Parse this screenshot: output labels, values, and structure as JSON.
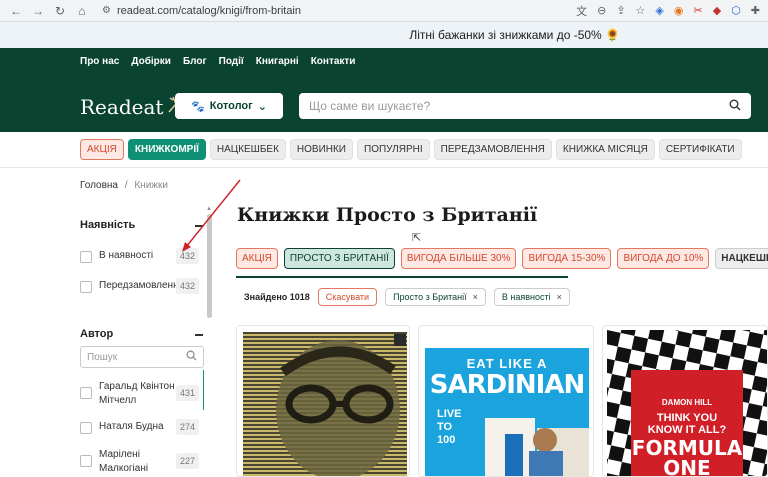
{
  "browser": {
    "url": "readeat.com/catalog/knigi/from-britain"
  },
  "promo": {
    "text": "Літні бажанки зі знижками до -50% 🌻"
  },
  "header": {
    "nav": [
      "Про нас",
      "Добірки",
      "Блог",
      "Події",
      "Книгарні",
      "Контакти"
    ],
    "logo": "Readeat",
    "catalog_label": "Котолог",
    "search_placeholder": "Що саме ви шукаєте?"
  },
  "tags": [
    {
      "label": "АКЦІЯ",
      "style": "red"
    },
    {
      "label": "КНИЖКОМРІЇ",
      "style": "green"
    },
    {
      "label": "НАЦКЕШБЕК",
      "style": "grey"
    },
    {
      "label": "НОВИНКИ",
      "style": "grey"
    },
    {
      "label": "ПОПУЛЯРНІ",
      "style": "grey"
    },
    {
      "label": "ПЕРЕДЗАМОВЛЕННЯ",
      "style": "grey"
    },
    {
      "label": "КНИЖКА МІСЯЦЯ",
      "style": "grey"
    },
    {
      "label": "СЕРТИФІКАТИ",
      "style": "grey"
    }
  ],
  "breadcrumb": {
    "home": "Головна",
    "sep": "/",
    "current": "Книжки"
  },
  "filters": {
    "availability": {
      "title": "Наявність",
      "items": [
        {
          "label": "В наявності",
          "count": "432"
        },
        {
          "label": "Передзамовлення",
          "count": "432"
        }
      ]
    },
    "author": {
      "title": "Автор",
      "search_placeholder": "Пошук",
      "items": [
        {
          "label": "Гаральд Квінтон Мітчелл",
          "count": "431"
        },
        {
          "label": "Наталя Будна",
          "count": "274"
        },
        {
          "label": "Марілені Малкогіані",
          "count": "227"
        }
      ]
    }
  },
  "main": {
    "title": "Книжки Просто з Британії",
    "filter_tags": [
      {
        "label": "АКЦІЯ",
        "style": "red"
      },
      {
        "label": "ПРОСТО З БРИТАНІЇ",
        "style": "active"
      },
      {
        "label": "ВИГОДА БІЛЬШЕ 30%",
        "style": "red"
      },
      {
        "label": "ВИГОДА 15-30%",
        "style": "red"
      },
      {
        "label": "ВИГОДА ДО 10%",
        "style": "red"
      },
      {
        "label": "НАЦКЕШБЕК",
        "style": "grey"
      }
    ],
    "found": "Знайдено 1018",
    "cancel": "Скасувати",
    "chips": [
      "Просто з Британії",
      "В наявності"
    ],
    "chip_close": "×"
  },
  "books": [
    {
      "cover_text": []
    },
    {
      "cover_text": [
        "EAT LIKE A",
        "SARDINIAN",
        "LIVE",
        "TO",
        "100"
      ]
    },
    {
      "cover_text": [
        "THINK YOU",
        "KNOW IT ALL?",
        "FORMULA",
        "ONE",
        "DAMON HILL"
      ]
    }
  ],
  "colors": {
    "header_bg": "#0b4331",
    "accent_green": "#0f8f74",
    "accent_red": "#d24a2d",
    "annotation_arrow": "#d0202a"
  }
}
